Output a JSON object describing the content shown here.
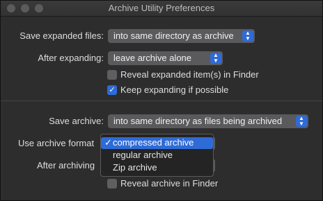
{
  "window": {
    "title": "Archive Utility Preferences"
  },
  "expand": {
    "save_label": "Save expanded files:",
    "save_value": "into same directory as archive",
    "after_label": "After expanding:",
    "after_value": "leave archive alone",
    "reveal_label": "Reveal expanded item(s) in Finder",
    "keep_label": "Keep expanding if possible",
    "reveal_checked": false,
    "keep_checked": true
  },
  "archive": {
    "save_label": "Save archive:",
    "save_value": "into same directory as files being archived",
    "format_label": "Use archive format",
    "after_label": "After archiving",
    "reveal_label": "Reveal archive in Finder",
    "reveal_checked": false
  },
  "format_menu": {
    "items": [
      "compressed archive",
      "regular archive",
      "Zip archive"
    ],
    "selected": "compressed archive"
  },
  "colors": {
    "accent": "#2f6bd6",
    "background": "#2d2d2d"
  }
}
